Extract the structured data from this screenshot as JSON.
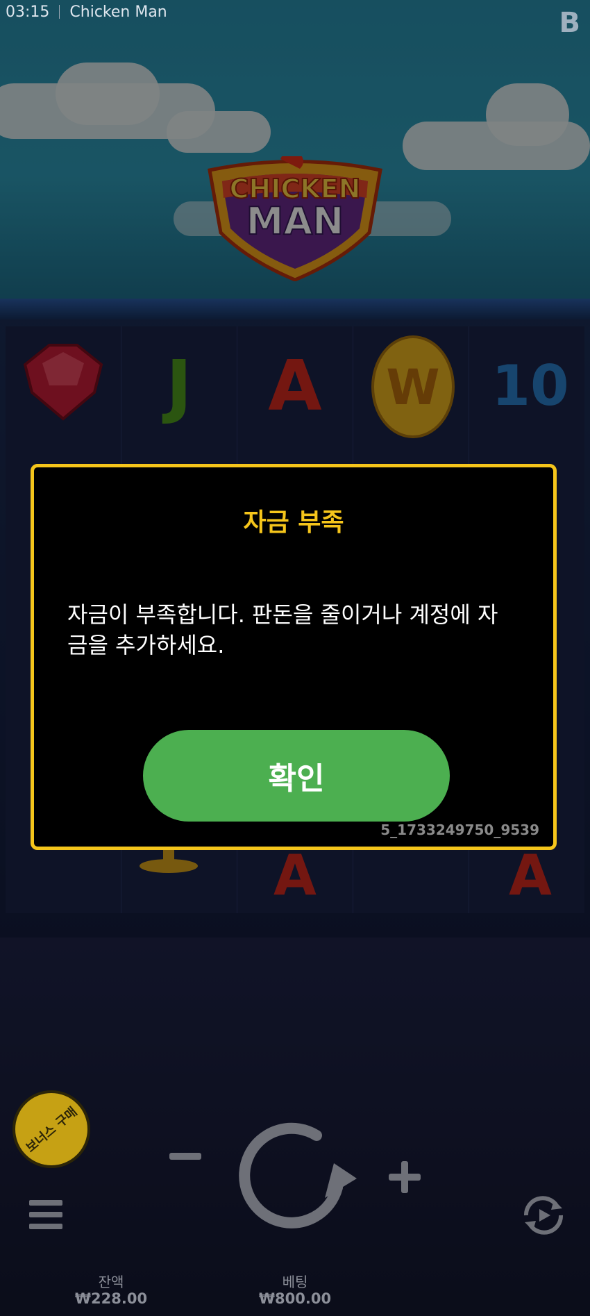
{
  "status_bar": {
    "time": "03:15",
    "app_title": "Chicken Man",
    "corner_badge": "B"
  },
  "game_logo": {
    "line1": "CHICKEN",
    "line2": "MAN"
  },
  "reels": {
    "top_row": [
      "ruby-gem",
      "J",
      "A",
      "W",
      "10"
    ]
  },
  "modal": {
    "title": "자금 부족",
    "message": "자금이 부족합니다. 판돈을 줄이거나 계정에 자금을 추가하세요.",
    "confirm_label": "확인",
    "session_id": "5_1733249750_9539"
  },
  "controls": {
    "bonus_buy_label": "보너스 구매",
    "balance_label": "잔액",
    "balance_value": "₩228.00",
    "bet_label": "베팅",
    "bet_value": "₩800.00"
  },
  "colors": {
    "accent": "#f5c51b",
    "confirm": "#4caf50",
    "modal_bg": "#000000"
  }
}
